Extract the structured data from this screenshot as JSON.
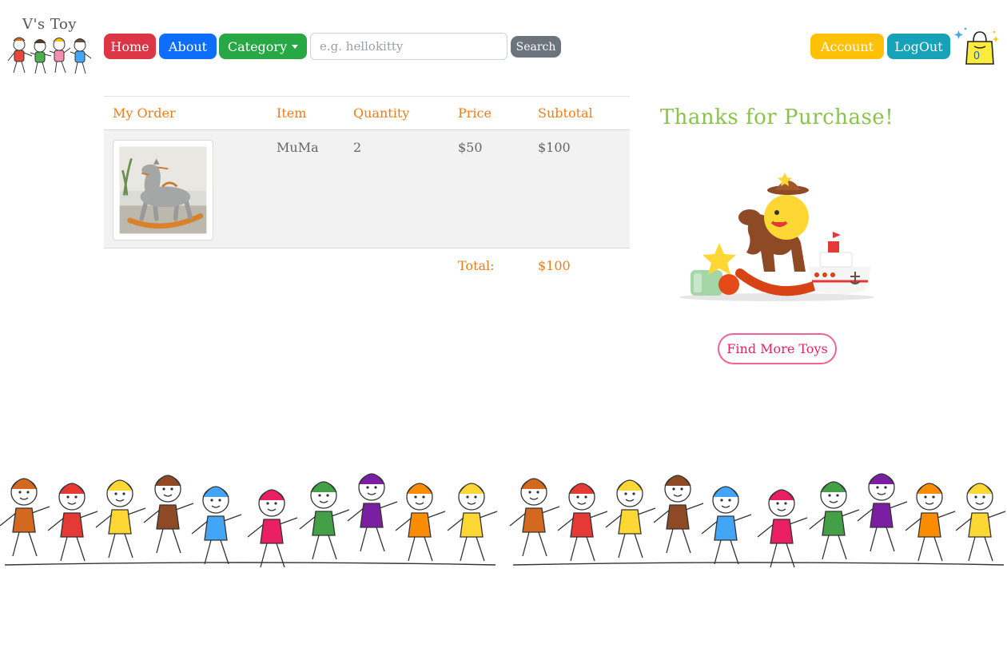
{
  "header": {
    "logo_text": "V's Toy",
    "nav": {
      "home": "Home",
      "about": "About",
      "category": "Category"
    },
    "search": {
      "placeholder": "e.g. hellokitty",
      "value": "",
      "button": "Search"
    },
    "account": "Account",
    "logout": "LogOut",
    "cart_count": "0",
    "colors": {
      "home": "#dc3545",
      "about": "#0d6efd",
      "category": "#28a745",
      "search": "#6c757d",
      "account": "#ffc107",
      "logout": "#17a2b8"
    }
  },
  "order": {
    "columns": [
      "My Order",
      "Item",
      "Quantity",
      "Price",
      "Subtotal"
    ],
    "rows": [
      {
        "item": "MuMa",
        "quantity": "2",
        "price": "$50",
        "subtotal": "$100",
        "image": "rocking-horse-plush"
      }
    ],
    "total_label": "Total:",
    "total_value": "$100"
  },
  "confirmation": {
    "title": "Thanks for Purchase!",
    "button": "Find More Toys",
    "illustration": "toys-illustration"
  },
  "footer_art": "dancing-kids-banner"
}
